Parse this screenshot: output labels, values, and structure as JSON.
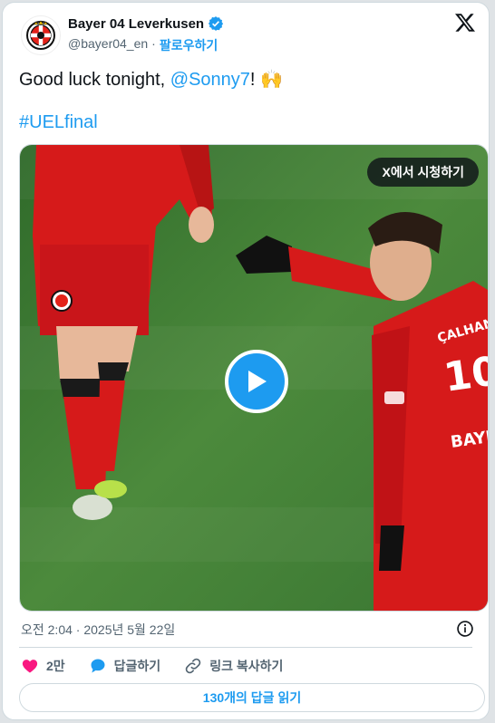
{
  "account": {
    "name": "Bayer 04 Leverkusen",
    "handle": "@bayer04_en",
    "separator": "·",
    "follow_label": "팔로우하기"
  },
  "tweet": {
    "text_before": "Good luck tonight, ",
    "mention": "@Sonny7",
    "text_after": "! 🙌",
    "hashtag": "#UELfinal"
  },
  "media": {
    "watch_label": "X에서 시청하기",
    "jersey_name": "ÇALHANOĞLU",
    "jersey_number": "10",
    "sponsor_text": "BAYE"
  },
  "timestamp": "오전 2:04 · 2025년 5월 22일",
  "actions": {
    "likes": "2만",
    "reply_label": "답글하기",
    "copy_link_label": "링크 복사하기"
  },
  "read_replies_label": "130개의 답글 읽기",
  "colors": {
    "accent": "#1d9bf0",
    "like": "#f91880",
    "verified": "#1d9bf0",
    "pitch": "#3f7a34",
    "kit": "#d61a1a"
  }
}
